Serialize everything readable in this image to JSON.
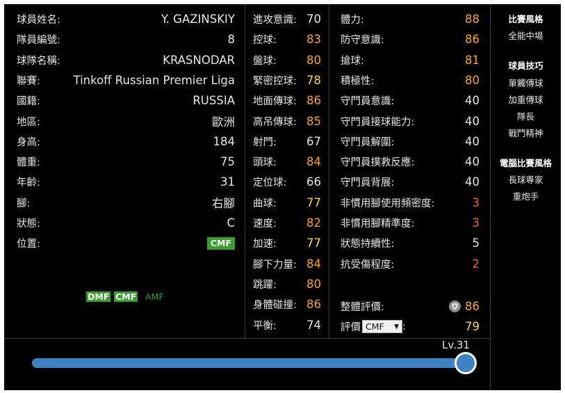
{
  "info": [
    {
      "label": "球員姓名:",
      "value": "Y. GAZINSKIY"
    },
    {
      "label": "隊員編號:",
      "value": "8"
    },
    {
      "label": "球隊名稱:",
      "value": "KRASNODAR"
    },
    {
      "label": "聯賽:",
      "value": "Tinkoff Russian Premier Liga"
    },
    {
      "label": "國籍:",
      "value": "RUSSIA"
    },
    {
      "label": "地區:",
      "value": "歐洲"
    },
    {
      "label": "身高:",
      "value": "184"
    },
    {
      "label": "體重:",
      "value": "75"
    },
    {
      "label": "年齡:",
      "value": "31"
    },
    {
      "label": "腳:",
      "value": "右腳"
    },
    {
      "label": "狀態:",
      "value": "C"
    },
    {
      "label": "位置:",
      "value": "CMF"
    }
  ],
  "positions": [
    {
      "label": "DMF",
      "active": true
    },
    {
      "label": "CMF",
      "active": true
    },
    {
      "label": "AMF",
      "active": false
    }
  ],
  "stats_a": [
    {
      "label": "進攻意識:",
      "value": "70",
      "color": "#e6e6e6"
    },
    {
      "label": "控球:",
      "value": "83",
      "color": "#ffa317"
    },
    {
      "label": "盤球:",
      "value": "80",
      "color": "#ffa317"
    },
    {
      "label": "緊密控球:",
      "value": "78",
      "color": "#ffd83c"
    },
    {
      "label": "地面傳球:",
      "value": "86",
      "color": "#ffa317"
    },
    {
      "label": "高吊傳球:",
      "value": "85",
      "color": "#ffa317"
    },
    {
      "label": "射門:",
      "value": "67",
      "color": "#e6e6e6"
    },
    {
      "label": "頭球:",
      "value": "84",
      "color": "#ffa317"
    },
    {
      "label": "定位球:",
      "value": "66",
      "color": "#e6e6e6"
    },
    {
      "label": "曲球:",
      "value": "77",
      "color": "#ffd83c"
    },
    {
      "label": "速度:",
      "value": "82",
      "color": "#ffa317"
    },
    {
      "label": "加速:",
      "value": "77",
      "color": "#ffd83c"
    },
    {
      "label": "腳下力量:",
      "value": "84",
      "color": "#ffa317"
    },
    {
      "label": "跳躍:",
      "value": "80",
      "color": "#ffa317"
    },
    {
      "label": "身體碰撞:",
      "value": "86",
      "color": "#ffa317"
    },
    {
      "label": "平衡:",
      "value": "74",
      "color": "#e6e6e6"
    }
  ],
  "stats_b": [
    {
      "label": "體力:",
      "value": "88",
      "color": "#ffa317"
    },
    {
      "label": "防守意識:",
      "value": "86",
      "color": "#ffa317"
    },
    {
      "label": "搶球:",
      "value": "81",
      "color": "#ffa317"
    },
    {
      "label": "積極性:",
      "value": "80",
      "color": "#ffa317"
    },
    {
      "label": "守門員意識:",
      "value": "40",
      "color": "#e6e6e6"
    },
    {
      "label": "守門員接球能力:",
      "value": "40",
      "color": "#e6e6e6"
    },
    {
      "label": "守門員解圍:",
      "value": "40",
      "color": "#e6e6e6"
    },
    {
      "label": "守門員撲救反應:",
      "value": "40",
      "color": "#e6e6e6"
    },
    {
      "label": "守門員背展:",
      "value": "40",
      "color": "#e6e6e6"
    },
    {
      "label": "非慣用腳使用頻密度:",
      "value": "3",
      "color": "#ff5e22"
    },
    {
      "label": "非慣用腳精準度:",
      "value": "3",
      "color": "#ff5e22"
    },
    {
      "label": "狀態持續性:",
      "value": "5",
      "color": "#e6e6e6"
    },
    {
      "label": "抗受傷程度:",
      "value": "2",
      "color": "#ff5e22"
    }
  ],
  "overall": {
    "label": "整體評價:",
    "value": "86",
    "icon": "shield-icon"
  },
  "rating": {
    "label_a": "評價",
    "select_value": "CMF",
    "label_b": ":",
    "value": "79"
  },
  "side": {
    "play_style_title": "比賽風格",
    "play_style": "全能中場",
    "skills_title": "球員技巧",
    "skills": [
      "單觸傳球",
      "加重傳球",
      "隊長",
      "戰鬥精神"
    ],
    "com_style_title": "電腦比賽風格",
    "com_styles": [
      "長球專家",
      "重炮手"
    ]
  },
  "level": {
    "label": "Lv.31",
    "fraction": 1.0
  }
}
